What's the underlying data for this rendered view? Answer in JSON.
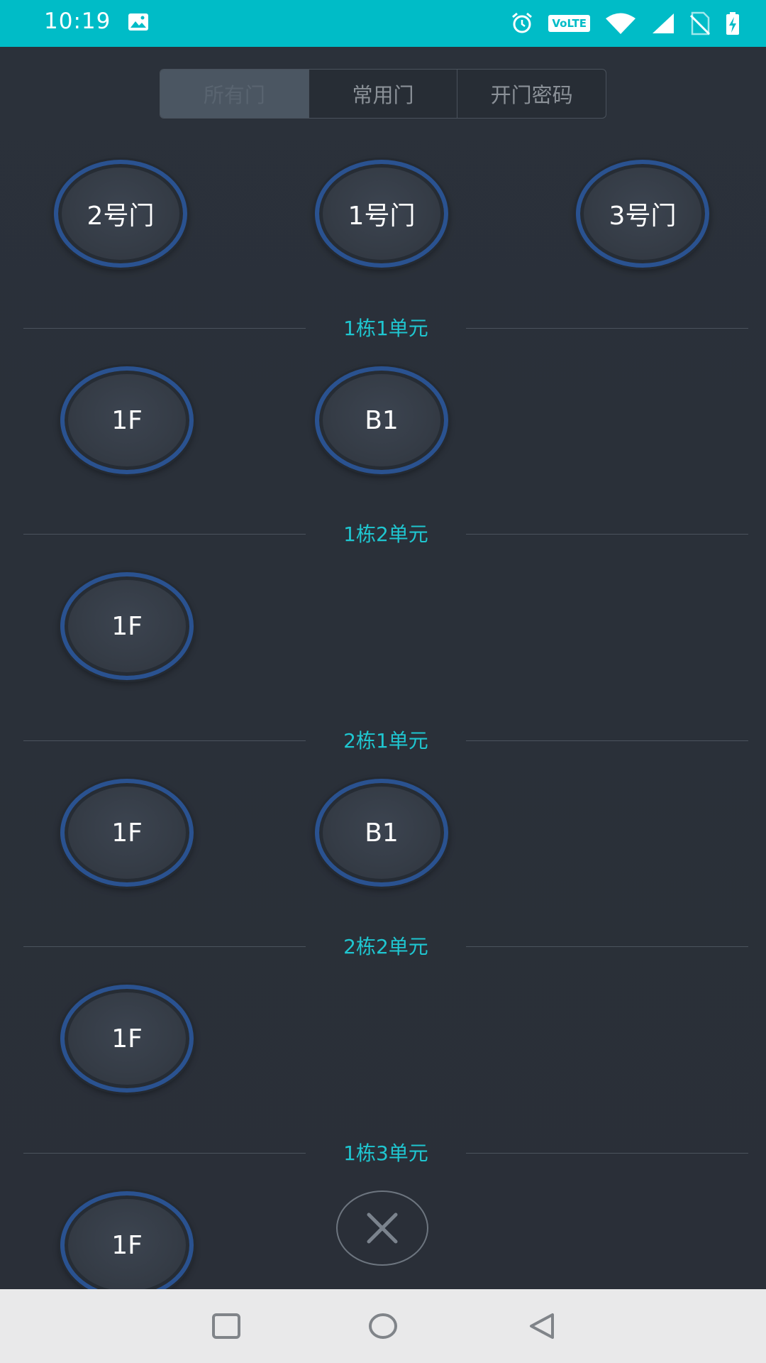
{
  "status_bar": {
    "time": "10:19",
    "volte": "VoLTE",
    "icons": [
      "image-icon",
      "alarm-icon",
      "volte-icon",
      "wifi-icon",
      "signal-icon",
      "no-sim-icon",
      "battery-charging-icon"
    ]
  },
  "tabs": [
    {
      "label": "所有门",
      "active": true
    },
    {
      "label": "常用门",
      "active": false
    },
    {
      "label": "开门密码",
      "active": false
    }
  ],
  "gates": [
    "2号门",
    "1号门",
    "3号门"
  ],
  "sections": [
    {
      "title": "1栋1单元",
      "doors": [
        "1F",
        "B1"
      ]
    },
    {
      "title": "1栋2单元",
      "doors": [
        "1F"
      ]
    },
    {
      "title": "2栋1单元",
      "doors": [
        "1F",
        "B1"
      ]
    },
    {
      "title": "2栋2单元",
      "doors": [
        "1F"
      ]
    },
    {
      "title": "1栋3单元",
      "doors": [
        "1F"
      ]
    }
  ],
  "colors": {
    "status_bar": "#00bcc7",
    "accent_text": "#1fc6d0",
    "ring": "#2a5290",
    "background": "#2a3039"
  },
  "nav": [
    "recents-square-icon",
    "home-circle-icon",
    "back-triangle-icon"
  ]
}
